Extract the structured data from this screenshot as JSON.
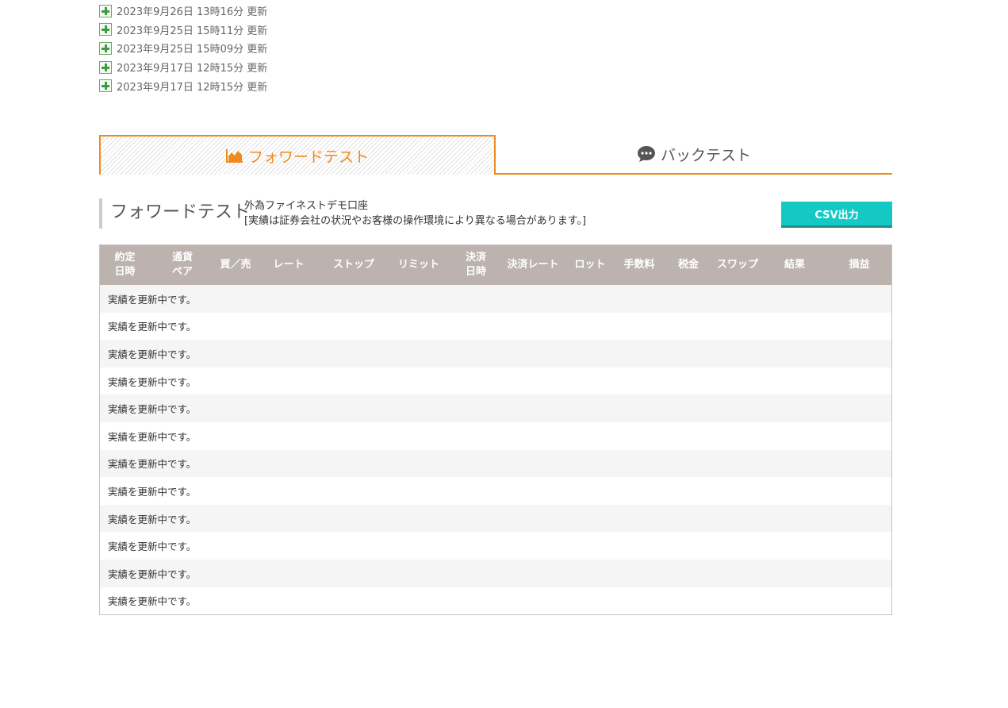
{
  "updates": [
    "2023年9月26日 13時16分 更新",
    "2023年9月25日 15時11分 更新",
    "2023年9月25日 15時09分 更新",
    "2023年9月17日 12時15分 更新",
    "2023年9月17日 12時15分 更新"
  ],
  "tabs": {
    "forward_label": "フォワードテスト",
    "back_label": "バックテスト",
    "forward_icon": "area-chart-icon",
    "back_icon": "speech-bubble-icon"
  },
  "section": {
    "title": "フォワードテスト",
    "account": "外為ファイネストデモ口座",
    "note": "[実績は証券会社の状況やお客様の操作環境により異なる場合があります。]",
    "csv_label": "CSV出力"
  },
  "table": {
    "headers": [
      "約定\n日時",
      "通貨\nペア",
      "買／売",
      "レート",
      "ストップ",
      "リミット",
      "決済\n日時",
      "決済レート",
      "ロット",
      "手数料",
      "税金",
      "スワップ",
      "結果",
      "損益"
    ],
    "rows": [
      "実績を更新中です。",
      "実績を更新中です。",
      "実績を更新中です。",
      "実績を更新中です。",
      "実績を更新中です。",
      "実績を更新中です。",
      "実績を更新中です。",
      "実績を更新中です。",
      "実績を更新中です。",
      "実績を更新中です。",
      "実績を更新中です。",
      "実績を更新中です。"
    ]
  },
  "colors": {
    "accent": "#f08a1c",
    "header_bg": "#bcb2ae",
    "csv_button": "#14c9c3"
  }
}
